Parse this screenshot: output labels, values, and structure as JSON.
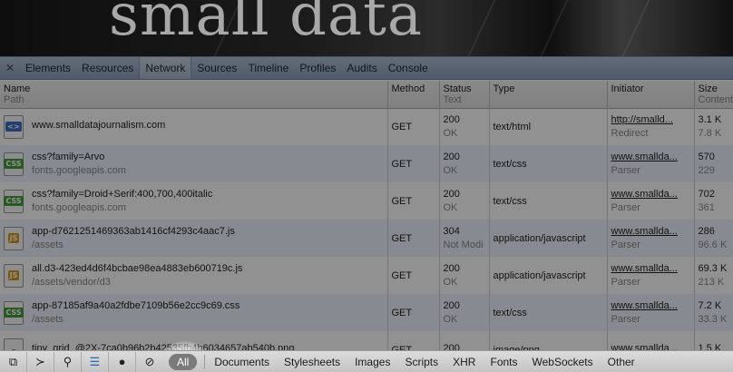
{
  "banner": {
    "site_title": "small data"
  },
  "tabs": [
    {
      "label": "Elements",
      "active": false
    },
    {
      "label": "Resources",
      "active": false
    },
    {
      "label": "Network",
      "active": true
    },
    {
      "label": "Sources",
      "active": false
    },
    {
      "label": "Timeline",
      "active": false
    },
    {
      "label": "Profiles",
      "active": false
    },
    {
      "label": "Audits",
      "active": false
    },
    {
      "label": "Console",
      "active": false
    }
  ],
  "columns": {
    "name": {
      "title": "Name",
      "sub": "Path"
    },
    "method": {
      "title": "Method"
    },
    "status": {
      "title": "Status",
      "sub": "Text"
    },
    "type": {
      "title": "Type"
    },
    "initiator": {
      "title": "Initiator"
    },
    "size": {
      "title": "Size",
      "sub": "Content"
    }
  },
  "rows": [
    {
      "icon": "html-file-icon",
      "badge": "<>",
      "kind": "html",
      "name": "www.smalldatajournalism.com",
      "path": "",
      "method": "GET",
      "status": "200",
      "status_text": "OK",
      "type": "text/html",
      "initiator": "http://smalld...",
      "initiator_sub": "Redirect",
      "size": "3.1 K",
      "content": "7.8 K"
    },
    {
      "icon": "css-file-icon",
      "badge": "CSS",
      "kind": "css",
      "name": "css?family=Arvo",
      "path": "fonts.googleapis.com",
      "method": "GET",
      "status": "200",
      "status_text": "OK",
      "type": "text/css",
      "initiator": "www.smallda...",
      "initiator_sub": "Parser",
      "size": "570",
      "content": "229"
    },
    {
      "icon": "css-file-icon",
      "badge": "CSS",
      "kind": "css",
      "name": "css?family=Droid+Serif:400,700,400italic",
      "path": "fonts.googleapis.com",
      "method": "GET",
      "status": "200",
      "status_text": "OK",
      "type": "text/css",
      "initiator": "www.smallda...",
      "initiator_sub": "Parser",
      "size": "702",
      "content": "361"
    },
    {
      "icon": "js-file-icon",
      "badge": "JS",
      "kind": "js",
      "name": "app-d7621251469363ab1416cf4293c4aac7.js",
      "path": "/assets",
      "method": "GET",
      "status": "304",
      "status_text": "Not Modi",
      "type": "application/javascript",
      "initiator": "www.smallda...",
      "initiator_sub": "Parser",
      "size": "286",
      "content": "96.6 K"
    },
    {
      "icon": "js-file-icon",
      "badge": "JS",
      "kind": "js",
      "name": "all.d3-423ed4d6f4bcbae98ea4883eb600719c.js",
      "path": "/assets/vendor/d3",
      "method": "GET",
      "status": "200",
      "status_text": "OK",
      "type": "application/javascript",
      "initiator": "www.smallda...",
      "initiator_sub": "Parser",
      "size": "69.3 K",
      "content": "213 K"
    },
    {
      "icon": "css-file-icon",
      "badge": "CSS",
      "kind": "css",
      "name": "app-87185af9a40a2fdbe7109b56e2cc9c69.css",
      "path": "/assets",
      "method": "GET",
      "status": "200",
      "status_text": "OK",
      "type": "text/css",
      "initiator": "www.smallda...",
      "initiator_sub": "Parser",
      "size": "7.2 K",
      "content": "33.3 K"
    },
    {
      "icon": "png-file-icon",
      "badge": "",
      "kind": "png",
      "name": "tiny_grid_@2X-7ca0b96b2b42535fb4b6034657ab540b.png",
      "path": "",
      "method": "GET",
      "status": "200",
      "status_text": "",
      "type": "image/png",
      "initiator": "www.smallda...",
      "initiator_sub": "",
      "size": "1.5 K",
      "content": ""
    }
  ],
  "filters": [
    {
      "label": "All",
      "selected": true
    },
    {
      "label": "Documents",
      "selected": false
    },
    {
      "label": "Stylesheets",
      "selected": false
    },
    {
      "label": "Images",
      "selected": false
    },
    {
      "label": "Scripts",
      "selected": false
    },
    {
      "label": "XHR",
      "selected": false
    },
    {
      "label": "Fonts",
      "selected": false
    },
    {
      "label": "WebSockets",
      "selected": false
    },
    {
      "label": "Other",
      "selected": false
    }
  ],
  "toolbar_icons": [
    "dock-icon",
    "console-toggle-icon",
    "search-icon",
    "waterfall-icon",
    "record-icon",
    "clear-icon"
  ]
}
